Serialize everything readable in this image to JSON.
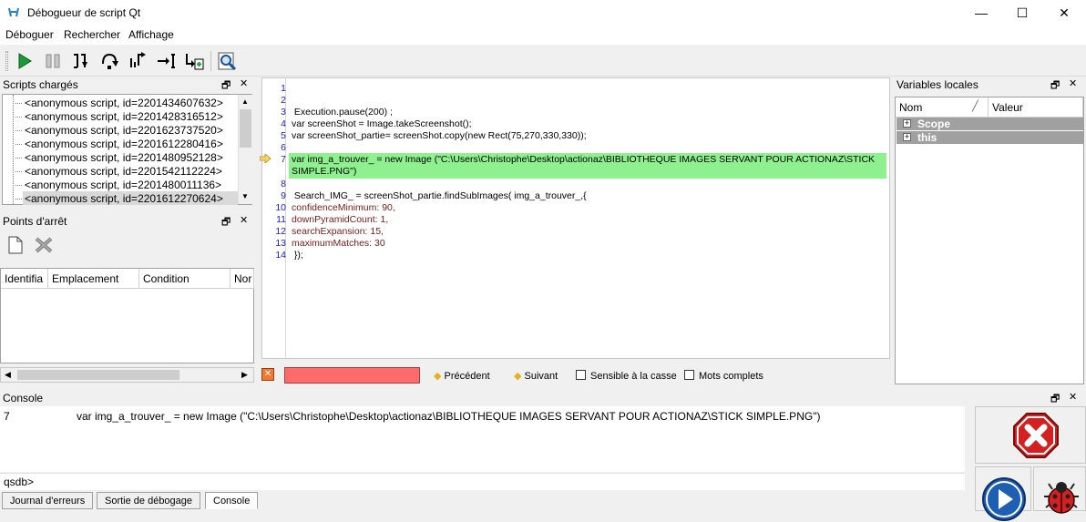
{
  "window": {
    "title": "Débogueur de script Qt",
    "minimize_glyph": "—",
    "maximize_glyph": "☐",
    "close_glyph": "✕"
  },
  "menu": {
    "items": [
      "Déboguer",
      "Rechercher",
      "Affichage"
    ]
  },
  "toolbar": {
    "buttons": [
      "continue-icon",
      "interrupt-icon",
      "step-into-icon",
      "step-over-icon",
      "step-out-icon",
      "run-to-cursor-icon",
      "run-to-new-script-icon",
      "clear-debugger-icon"
    ]
  },
  "loaded_scripts": {
    "title": "Scripts chargés",
    "items": [
      "<anonymous script, id=2201434607632>",
      "<anonymous script, id=2201428316512>",
      "<anonymous script, id=2201623737520>",
      "<anonymous script, id=2201612280416>",
      "<anonymous script, id=2201480952128>",
      "<anonymous script, id=2201542112224>",
      "<anonymous script, id=2201480011136>",
      "<anonymous script, id=2201612270624>"
    ],
    "selected_index": 7
  },
  "breakpoints": {
    "title": "Points d'arrêt",
    "columns": [
      "Identifia",
      "Emplacement",
      "Condition",
      "Nor"
    ]
  },
  "locals": {
    "title": "Variables locales",
    "columns": [
      "Nom",
      "Valeur"
    ],
    "rows": [
      "Scope",
      "this"
    ]
  },
  "editor": {
    "current_line": 7,
    "lines": [
      {
        "n": "1",
        "text": ""
      },
      {
        "n": "2",
        "text": ""
      },
      {
        "n": "3",
        "text": " Execution.pause(200) ;"
      },
      {
        "n": "4",
        "text": "var screenShot = Image.takeScreenshot();"
      },
      {
        "n": "5",
        "text": "var screenShot_partie= screenShot.copy(new Rect(75,270,330,330));"
      },
      {
        "n": "6",
        "text": ""
      },
      {
        "n": "7",
        "text": "var img_a_trouver_ = new Image (\"C:\\Users\\Christophe\\Desktop\\actionaz\\BIBLIOTHEQUE IMAGES SERVANT POUR ACTIONAZ\\STICK"
      },
      {
        "n": "",
        "text": "SIMPLE.PNG\")"
      },
      {
        "n": "8",
        "text": ""
      },
      {
        "n": "9",
        "text": " Search_IMG_ = screenShot_partie.findSubImages( img_a_trouver_,{"
      },
      {
        "n": "10",
        "text": "confidenceMinimum: 90,"
      },
      {
        "n": "11",
        "text": "downPyramidCount: 1,"
      },
      {
        "n": "12",
        "text": "searchExpansion: 15,"
      },
      {
        "n": "13",
        "text": "maximumMatches: 30"
      },
      {
        "n": "14",
        "text": " });"
      }
    ]
  },
  "find_bar": {
    "search_value": "",
    "previous_label": "Précédent",
    "next_label": "Suivant",
    "case_label": "Sensible à la casse",
    "whole_label": "Mots complets"
  },
  "console": {
    "title": "Console",
    "output_line_no": "7",
    "output_text": "var img_a_trouver_ = new Image (\"C:\\Users\\Christophe\\Desktop\\actionaz\\BIBLIOTHEQUE IMAGES SERVANT POUR ACTIONAZ\\STICK SIMPLE.PNG\")",
    "prompt": "qsdb>"
  },
  "tabs": [
    "Journal d'erreurs",
    "Sortie de débogage",
    "Console"
  ],
  "active_tab": "Console",
  "colors": {
    "highlight": "#8ff08f",
    "find_field": "#ff6a6a",
    "locals_row": "#a0a0a0"
  }
}
